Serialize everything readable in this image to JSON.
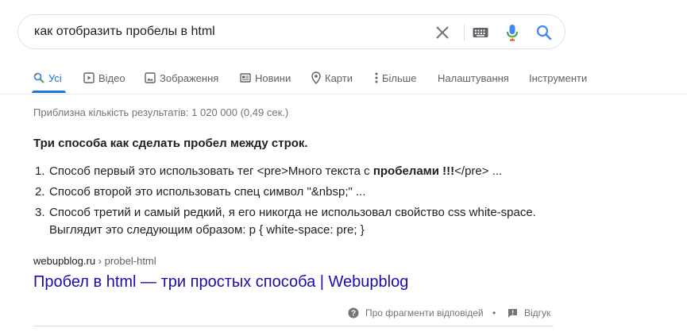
{
  "search": {
    "query": "как отобразить пробелы в html"
  },
  "tabs": [
    {
      "label": "Усі",
      "icon": "search-icon",
      "active": true
    },
    {
      "label": "Відео",
      "icon": "video-icon"
    },
    {
      "label": "Зображення",
      "icon": "image-icon"
    },
    {
      "label": "Новини",
      "icon": "news-icon"
    },
    {
      "label": "Карти",
      "icon": "map-pin-icon"
    },
    {
      "label": "Більше",
      "icon": "more-vert-icon"
    },
    {
      "label": "Налаштування"
    },
    {
      "label": "Інструменти"
    }
  ],
  "stats": "Приблизна кількість результатів: 1 020 000 (0,49 сек.)",
  "snippet": {
    "title": "Три способа как сделать пробел между строк.",
    "items": [
      {
        "num": "1.",
        "before": "Способ первый это использовать тег <pre>Много текста с ",
        "bold": "пробелами !!!",
        "after": "</pre> ..."
      },
      {
        "num": "2.",
        "text": "Способ второй это использовать спец символ \"&nbsp;\" ..."
      },
      {
        "num": "3.",
        "text": "Способ третий и самый редкий, я его никогда не использовал свойство css white-space. Выглядит это следующим образом: p { white-space: pre; }"
      }
    ]
  },
  "result": {
    "domain": "webupblog.ru",
    "separator": " › ",
    "path": "probel-html",
    "title": "Пробел в html — три простых способа | Webupblog"
  },
  "footer": {
    "about": "Про фрагменти відповідей",
    "dot": "•",
    "feedback": "Відгук"
  },
  "colors": {
    "accent": "#1a73e8",
    "link": "#1a0dab",
    "muted": "#70757a"
  }
}
